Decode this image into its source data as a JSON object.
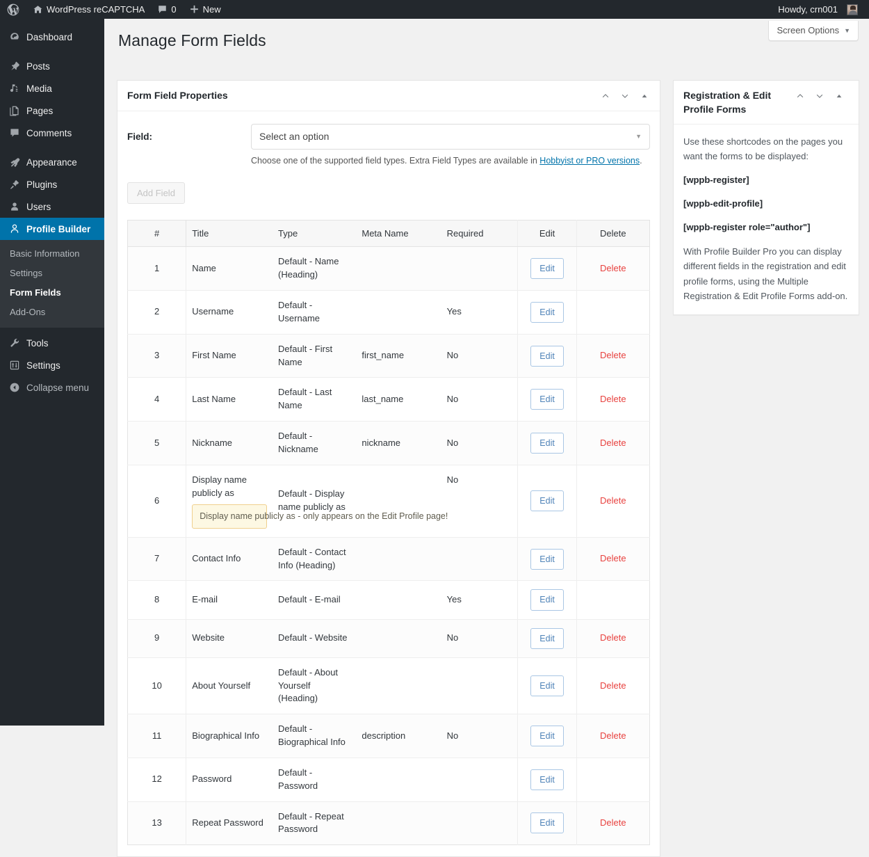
{
  "adminbar": {
    "site_name": "WordPress reCAPTCHA",
    "comments_count": "0",
    "new_label": "New",
    "howdy": "Howdy, crn001",
    "icons": {
      "wp_logo": "wordpress-logo-icon",
      "home": "home-icon",
      "comment": "comment-icon",
      "plus": "plus-icon"
    }
  },
  "sidebar": {
    "items": [
      {
        "label": "Dashboard",
        "icon": "dashboard-icon"
      },
      {
        "label": "Posts",
        "icon": "pin-icon"
      },
      {
        "label": "Media",
        "icon": "media-icon"
      },
      {
        "label": "Pages",
        "icon": "pages-icon"
      },
      {
        "label": "Comments",
        "icon": "comment-icon"
      },
      {
        "label": "Appearance",
        "icon": "brush-icon"
      },
      {
        "label": "Plugins",
        "icon": "plug-icon"
      },
      {
        "label": "Users",
        "icon": "user-icon"
      },
      {
        "label": "Profile Builder",
        "icon": "profile-icon"
      },
      {
        "label": "Tools",
        "icon": "wrench-icon"
      },
      {
        "label": "Settings",
        "icon": "settings-icon"
      },
      {
        "label": "Collapse menu",
        "icon": "collapse-icon"
      }
    ],
    "submenu": [
      {
        "label": "Basic Information"
      },
      {
        "label": "Settings"
      },
      {
        "label": "Form Fields"
      },
      {
        "label": "Add-Ons"
      }
    ],
    "active_submenu": "Form Fields",
    "current_item": "Profile Builder",
    "accent_color": "#0073aa"
  },
  "header": {
    "screen_options": "Screen Options",
    "screen_options_caret": "▼",
    "page_title": "Manage Form Fields"
  },
  "properties_panel": {
    "title": "Form Field Properties",
    "field_label": "Field:",
    "select_value": "Select an option",
    "select_placeholder": "Select an option",
    "description_prefix": "Choose one of the supported field types. Extra Field Types are available in ",
    "description_link": "Hobbyist or PRO versions",
    "description_suffix": ".",
    "add_field_label": "Add Field"
  },
  "table": {
    "columns": [
      "#",
      "Title",
      "Type",
      "Meta Name",
      "Required",
      "Edit",
      "Delete"
    ],
    "edit_label": "Edit",
    "delete_label": "Delete",
    "rows": [
      {
        "num": "1",
        "title": "Name",
        "type": "Default - Name (Heading)",
        "meta": "",
        "required": "",
        "edit": "Edit",
        "delete": "Delete",
        "note": ""
      },
      {
        "num": "2",
        "title": "Username",
        "type": "Default - Username",
        "meta": "",
        "required": "Yes",
        "edit": "Edit",
        "delete": "",
        "note": ""
      },
      {
        "num": "3",
        "title": "First Name",
        "type": "Default - First Name",
        "meta": "first_name",
        "required": "No",
        "edit": "Edit",
        "delete": "Delete",
        "note": ""
      },
      {
        "num": "4",
        "title": "Last Name",
        "type": "Default - Last Name",
        "meta": "last_name",
        "required": "No",
        "edit": "Edit",
        "delete": "Delete",
        "note": ""
      },
      {
        "num": "5",
        "title": "Nickname",
        "type": "Default - Nickname",
        "meta": "nickname",
        "required": "No",
        "edit": "Edit",
        "delete": "Delete",
        "note": ""
      },
      {
        "num": "6",
        "title": "Display name publicly as",
        "type": "Default - Display name publicly as",
        "meta": "",
        "required": "No",
        "edit": "Edit",
        "delete": "Delete",
        "note": "Display name publicly as - only appears on the Edit Profile page!"
      },
      {
        "num": "7",
        "title": "Contact Info",
        "type": "Default - Contact Info (Heading)",
        "meta": "",
        "required": "",
        "edit": "Edit",
        "delete": "Delete",
        "note": ""
      },
      {
        "num": "8",
        "title": "E-mail",
        "type": "Default - E-mail",
        "meta": "",
        "required": "Yes",
        "edit": "Edit",
        "delete": "",
        "note": ""
      },
      {
        "num": "9",
        "title": "Website",
        "type": "Default - Website",
        "meta": "",
        "required": "No",
        "edit": "Edit",
        "delete": "Delete",
        "note": ""
      },
      {
        "num": "10",
        "title": "About Yourself",
        "type": "Default - About Yourself (Heading)",
        "meta": "",
        "required": "",
        "edit": "Edit",
        "delete": "Delete",
        "note": ""
      },
      {
        "num": "11",
        "title": "Biographical Info",
        "type": "Default - Biographical Info",
        "meta": "description",
        "required": "No",
        "edit": "Edit",
        "delete": "Delete",
        "note": ""
      },
      {
        "num": "12",
        "title": "Password",
        "type": "Default - Password",
        "meta": "",
        "required": "",
        "edit": "Edit",
        "delete": "",
        "note": ""
      },
      {
        "num": "13",
        "title": "Repeat Password",
        "type": "Default - Repeat Password",
        "meta": "",
        "required": "",
        "edit": "Edit",
        "delete": "Delete",
        "note": ""
      }
    ]
  },
  "side_panel": {
    "title": "Registration & Edit Profile Forms",
    "intro": "Use these shortcodes on the pages you want the forms to be displayed:",
    "shortcodes": [
      "[wppb-register]",
      "[wppb-edit-profile]",
      "[wppb-register role=\"author\"]"
    ],
    "outro": "With Profile Builder Pro you can display different fields in the registration and edit profile forms, using the Multiple Registration & Edit Profile Forms add-on."
  },
  "colors": {
    "admin_bg": "#23282d",
    "submenu_bg": "#32373c",
    "accent": "#0073aa",
    "link": "#0073aa",
    "delete": "#e8423f",
    "edit_border": "#a9c6e4",
    "note_bg": "#fdf8e3",
    "note_border": "#f0cf8d"
  }
}
